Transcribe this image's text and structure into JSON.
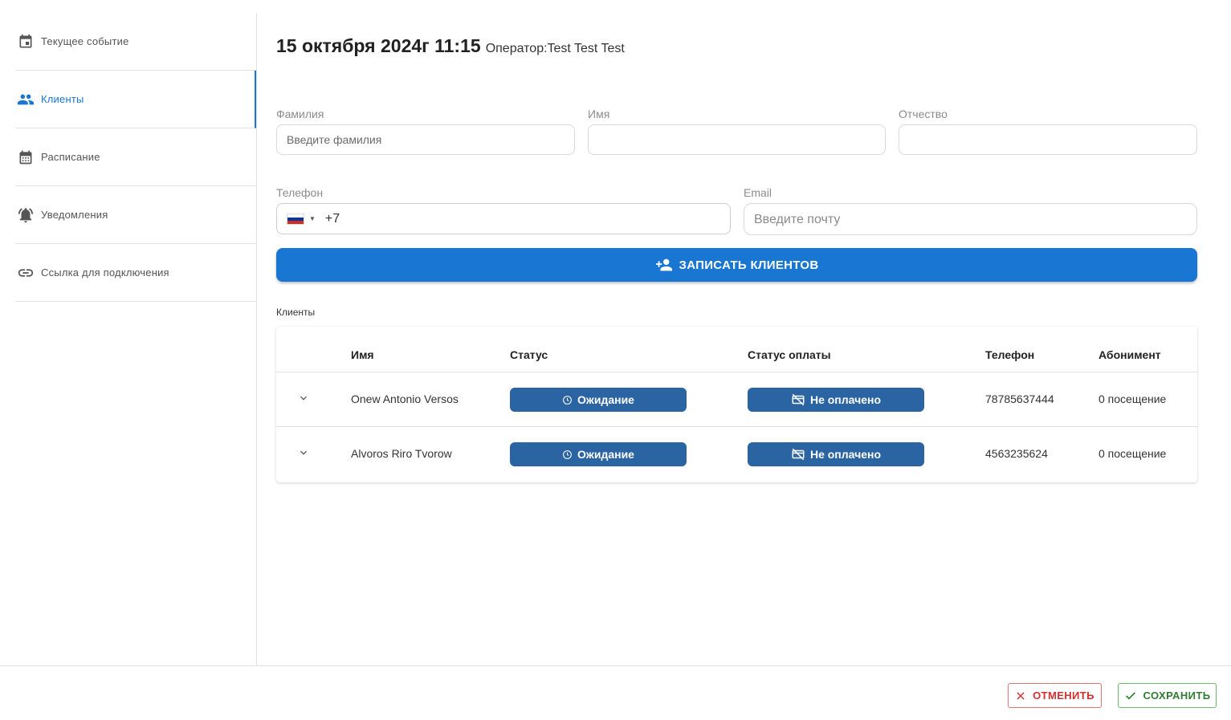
{
  "sidebar": {
    "items": [
      {
        "label": "Текущее событие",
        "icon": "calendar-event-icon"
      },
      {
        "label": "Клиенты",
        "icon": "people-icon",
        "active": true
      },
      {
        "label": "Расписание",
        "icon": "calendar-month-icon"
      },
      {
        "label": "Уведомления",
        "icon": "bell-alert-icon"
      },
      {
        "label": "Ссылка для подключения",
        "icon": "link-icon"
      }
    ]
  },
  "header": {
    "date": "15 октября 2024г 11:15",
    "operator": "Оператор:Test Test Test"
  },
  "form": {
    "last_name_label": "Фамилия",
    "last_name_placeholder": "Введите фамилия",
    "first_name_label": "Имя",
    "middle_name_label": "Отчество",
    "phone_label": "Телефон",
    "phone_value": "+7",
    "phone_country": "ru",
    "email_label": "Email",
    "email_placeholder": "Введите почту",
    "submit_label": "ЗАПИСАТЬ КЛИЕНТОВ"
  },
  "clients_table": {
    "caption": "Клиенты",
    "columns": [
      "Имя",
      "Статус",
      "Статус оплаты",
      "Телефон",
      "Абонимент"
    ],
    "rows": [
      {
        "name": "Onew Antonio Versos",
        "status": "Ожидание",
        "payment": "Не оплачено",
        "phone": "78785637444",
        "subscription": "0 посещение"
      },
      {
        "name": "Alvoros Riro Tvorow",
        "status": "Ожидание",
        "payment": "Не оплачено",
        "phone": "4563235624",
        "subscription": "0 посещение"
      }
    ]
  },
  "footer": {
    "cancel_label": "ОТМЕНИТЬ",
    "save_label": "СОХРАНИТЬ"
  },
  "colors": {
    "accent": "#1976d2",
    "pill": "#2b64a3",
    "cancel": "#d32f2f",
    "save": "#2e7d32"
  }
}
